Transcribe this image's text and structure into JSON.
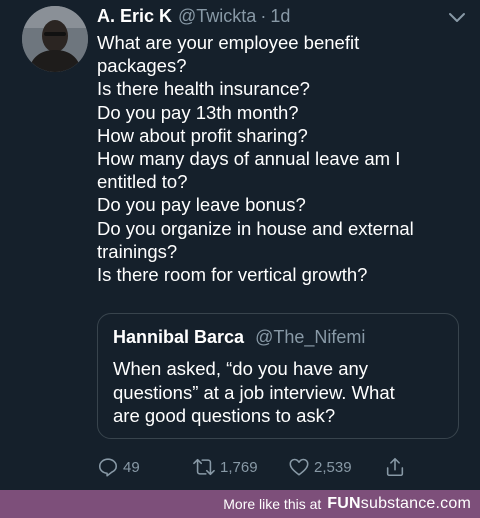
{
  "tweet": {
    "author_name": "A. Eric K",
    "handle": "@Twickta",
    "separator": "·",
    "time": "1d",
    "lines": [
      "What are your employee benefit",
      "packages?",
      "Is there health insurance?",
      "Do you pay 13th month?",
      "How about profit sharing?",
      "How many days of annual leave am I",
      "entitled to?",
      "Do you pay leave bonus?",
      "Do you organize in house and external",
      "trainings?",
      "Is there room for vertical growth?"
    ]
  },
  "quoted_tweet": {
    "author_name": "Hannibal Barca",
    "handle": "@The_Nifemi",
    "lines": [
      "When asked, “do you have any",
      "questions” at a job interview. What",
      "are good questions to ask?"
    ]
  },
  "actions": {
    "replies": "49",
    "retweets": "1,769",
    "likes": "2,539"
  },
  "footer": {
    "text": "More like this at",
    "site_prefix": "FUN",
    "site_suffix": "substance.com"
  },
  "icons": {
    "avatar": "avatar-photo",
    "menu": "chevron-down-icon",
    "reply": "reply-icon",
    "retweet": "retweet-icon",
    "like": "heart-icon",
    "share": "share-icon"
  },
  "colors": {
    "background": "#15202b",
    "secondary_text": "#8899a6",
    "border": "#38444d",
    "footer_bg": "#7d4f7a"
  }
}
